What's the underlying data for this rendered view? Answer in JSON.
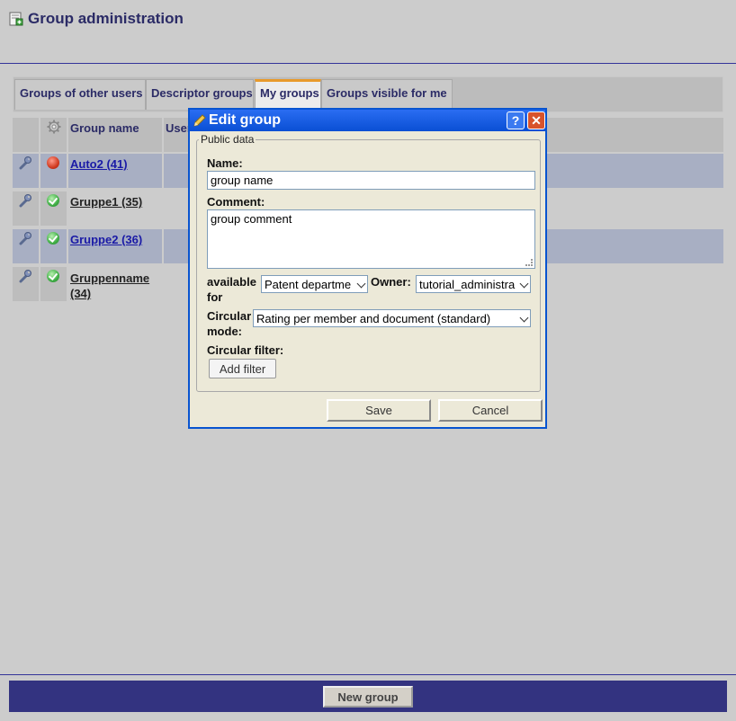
{
  "header": {
    "title": "Group administration"
  },
  "tabs": [
    {
      "label": "Groups of other users",
      "active": false
    },
    {
      "label": "Descriptor groups",
      "active": false
    },
    {
      "label": "My groups",
      "active": true
    },
    {
      "label": "Groups visible for me",
      "active": false
    }
  ],
  "table": {
    "headers": {
      "name": "Group name",
      "user": "User"
    },
    "rows": [
      {
        "name": "Auto2 (41)",
        "status": "red",
        "highlight": true
      },
      {
        "name": "Gruppe1 (35)",
        "status": "green",
        "highlight": false
      },
      {
        "name": "Gruppe2 (36)",
        "status": "green",
        "highlight": true
      },
      {
        "name_line1": "Gruppenname",
        "name_line2": "(34)",
        "status": "green",
        "highlight": false
      }
    ]
  },
  "footer": {
    "new_group_label": "New group"
  },
  "dialog": {
    "title": "Edit group",
    "help_label": "?",
    "close_label": "✕",
    "fieldset_legend": "Public data",
    "name_label": "Name:",
    "name_value": "group name",
    "comment_label": "Comment:",
    "comment_value": "group comment",
    "available_label_1": "available",
    "available_label_2": "for",
    "available_value": "Patent departme",
    "owner_label": "Owner:",
    "owner_value": "tutorial_administra",
    "circular_mode_label_1": "Circular",
    "circular_mode_label_2": "mode:",
    "circular_mode_value": "Rating per member and document (standard)",
    "circular_filter_label": "Circular filter:",
    "add_filter_label": "Add filter",
    "save_label": "Save",
    "cancel_label": "Cancel"
  },
  "colors": {
    "accent": "#333380",
    "dialog_title": "#0a4fd4",
    "highlight_row": "#a8afc3",
    "active_tab_marker": "#e89a2b"
  }
}
